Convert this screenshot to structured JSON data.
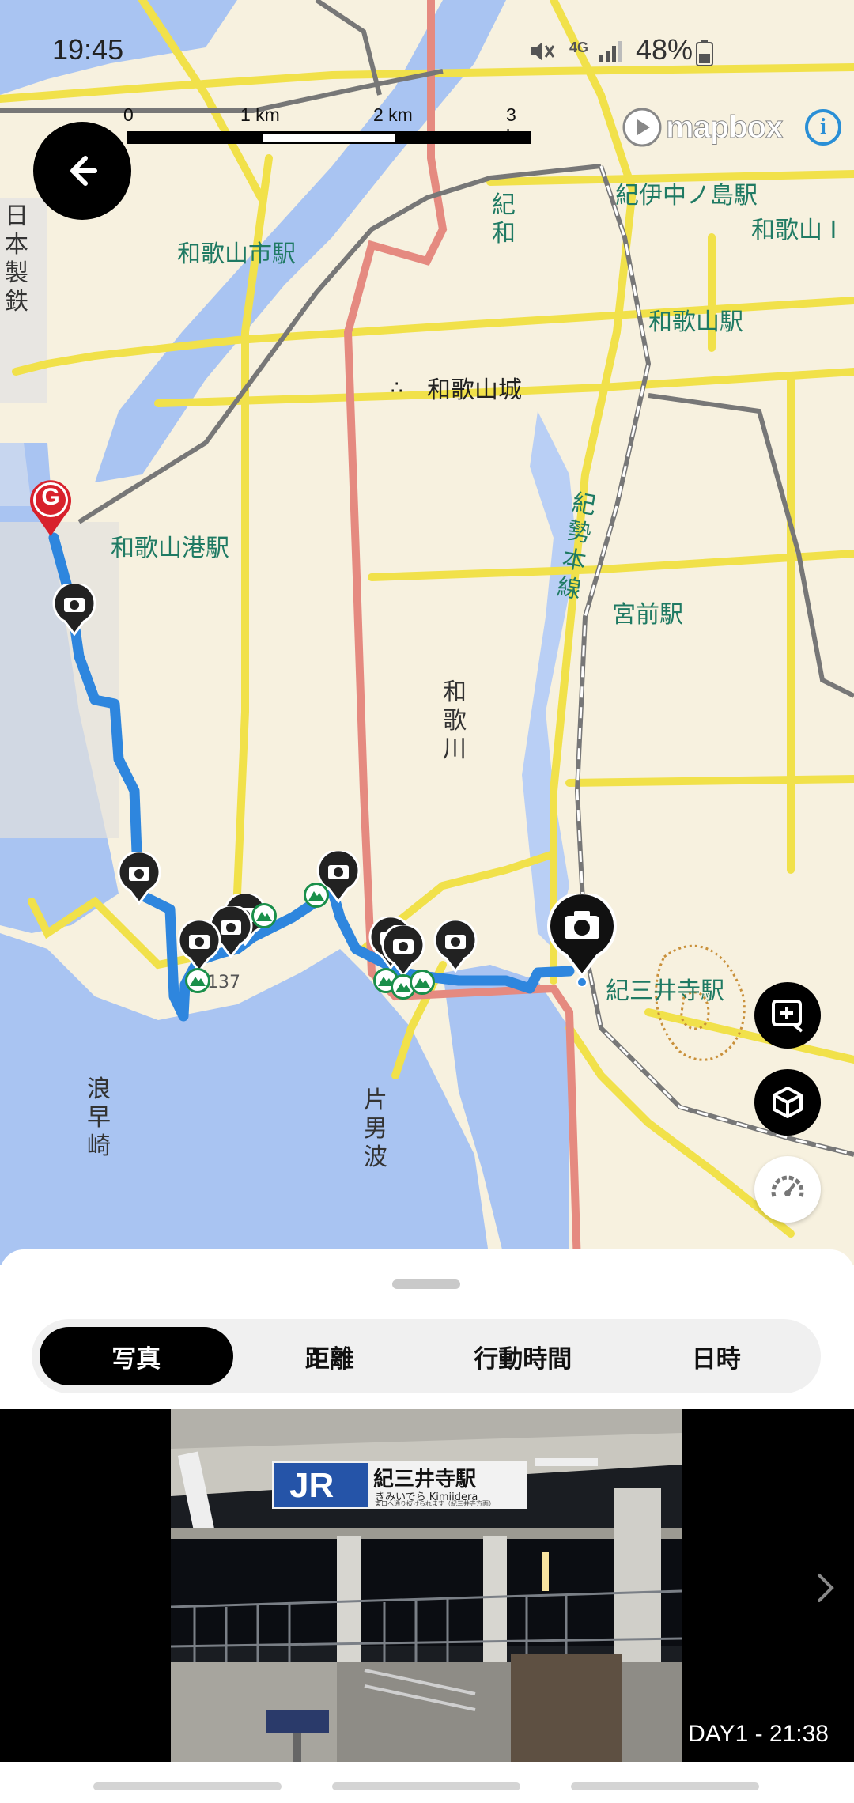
{
  "status_bar": {
    "time": "19:45",
    "network": "4G",
    "battery": "48%",
    "icons": [
      "mute-icon",
      "signal-icon",
      "battery-icon"
    ]
  },
  "map": {
    "attribution": "mapbox",
    "scale_labels": [
      "0",
      "1 km",
      "2 km",
      "3 km"
    ],
    "place_labels": {
      "wakayamashi_station": "和歌山市駅",
      "kii_nakanoshima_station": "紀伊中ノ島駅",
      "wakayama_station": "和歌山駅",
      "wakayama_castle": "和歌山城",
      "wakayamako_station": "和歌山港駅",
      "miyamae_station": "宮前駅",
      "kimiidera_station": "紀三井寺駅",
      "kiwa": "紀和",
      "kisei_line": "紀勢本線",
      "wakagawa": "和歌川",
      "nippon_steel": "日本製鉄",
      "namihaya": "浪早崎",
      "kataonami": "片男波",
      "route_number": "137",
      "wakayama_partial": "和歌山 I"
    },
    "goal_marker": "G",
    "colors": {
      "route": "#2e86de",
      "water": "#a9c4f2",
      "land": "#f7f1df",
      "major_road": "#e58a80",
      "road": "#f1e14a"
    }
  },
  "sheet": {
    "tabs": [
      {
        "label": "写真",
        "active": true
      },
      {
        "label": "距離",
        "active": false
      },
      {
        "label": "行動時間",
        "active": false
      },
      {
        "label": "日時",
        "active": false
      }
    ]
  },
  "photo": {
    "caption": "DAY1 - 21:38",
    "sign_main": "紀三井寺駅",
    "sign_sub": "きみいでら Kimiidera",
    "sign_logo": "JR",
    "sign_small": "東口へ通り抜けられます（紀三井寺方面）"
  }
}
